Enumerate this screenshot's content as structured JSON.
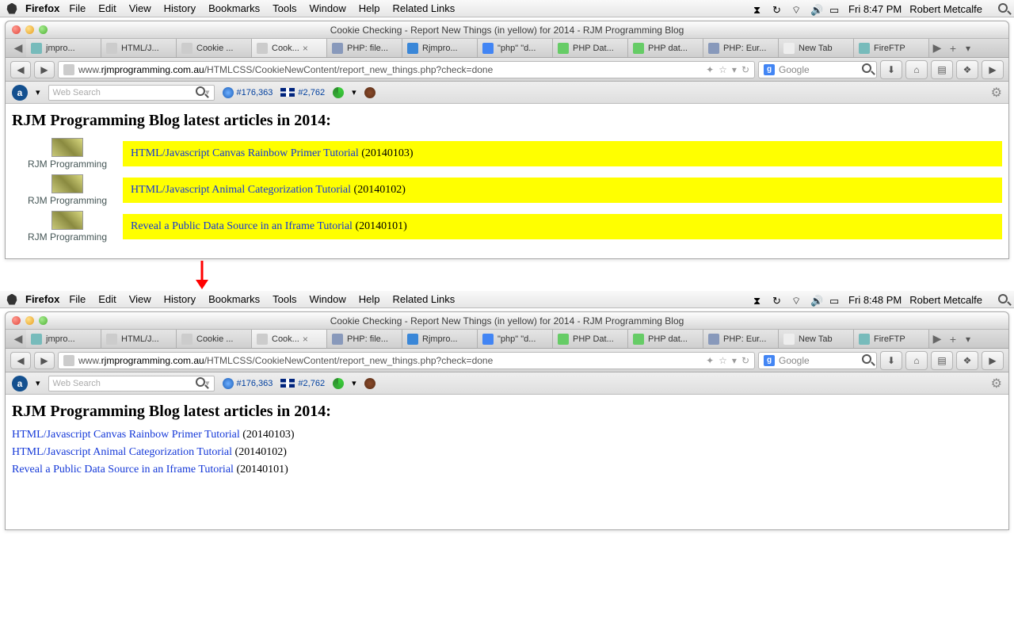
{
  "menubar": {
    "app": "Firefox",
    "items": [
      "File",
      "Edit",
      "View",
      "History",
      "Bookmarks",
      "Tools",
      "Window",
      "Help",
      "Related Links"
    ],
    "clock1": "Fri 8:47 PM",
    "clock2": "Fri 8:48 PM",
    "user": "Robert Metcalfe"
  },
  "window": {
    "title": "Cookie Checking - Report New Things (in yellow) for 2014 - RJM Programming Blog"
  },
  "tabs": [
    {
      "label": "jmpro..."
    },
    {
      "label": "HTML/J..."
    },
    {
      "label": "Cookie ..."
    },
    {
      "label": "Cook...",
      "active": true,
      "closable": true
    },
    {
      "label": "PHP: file..."
    },
    {
      "label": "Rjmpro..."
    },
    {
      "label": "\"php\" \"d..."
    },
    {
      "label": "PHP Dat..."
    },
    {
      "label": "PHP dat..."
    },
    {
      "label": "PHP: Eur..."
    },
    {
      "label": "New Tab"
    },
    {
      "label": "FireFTP"
    }
  ],
  "url": {
    "prefix": "www.",
    "domain": "rjmprogramming.com.au",
    "path": "/HTMLCSS/CookieNewContent/report_new_things.php?check=done"
  },
  "search": {
    "placeholder": "Google",
    "engine": "G"
  },
  "alexa": {
    "search_placeholder": "Web Search",
    "global_rank": "#176,363",
    "local_rank": "#2,762"
  },
  "page": {
    "heading": "RJM Programming Blog latest articles in 2014:",
    "logo_text": "RJM Programming",
    "articles": [
      {
        "title": "HTML/Javascript Canvas Rainbow Primer Tutorial",
        "date": "(20140103)"
      },
      {
        "title": "HTML/Javascript Animal Categorization Tutorial",
        "date": "(20140102)"
      },
      {
        "title": "Reveal a Public Data Source in an Iframe Tutorial",
        "date": "(20140101)"
      }
    ]
  }
}
